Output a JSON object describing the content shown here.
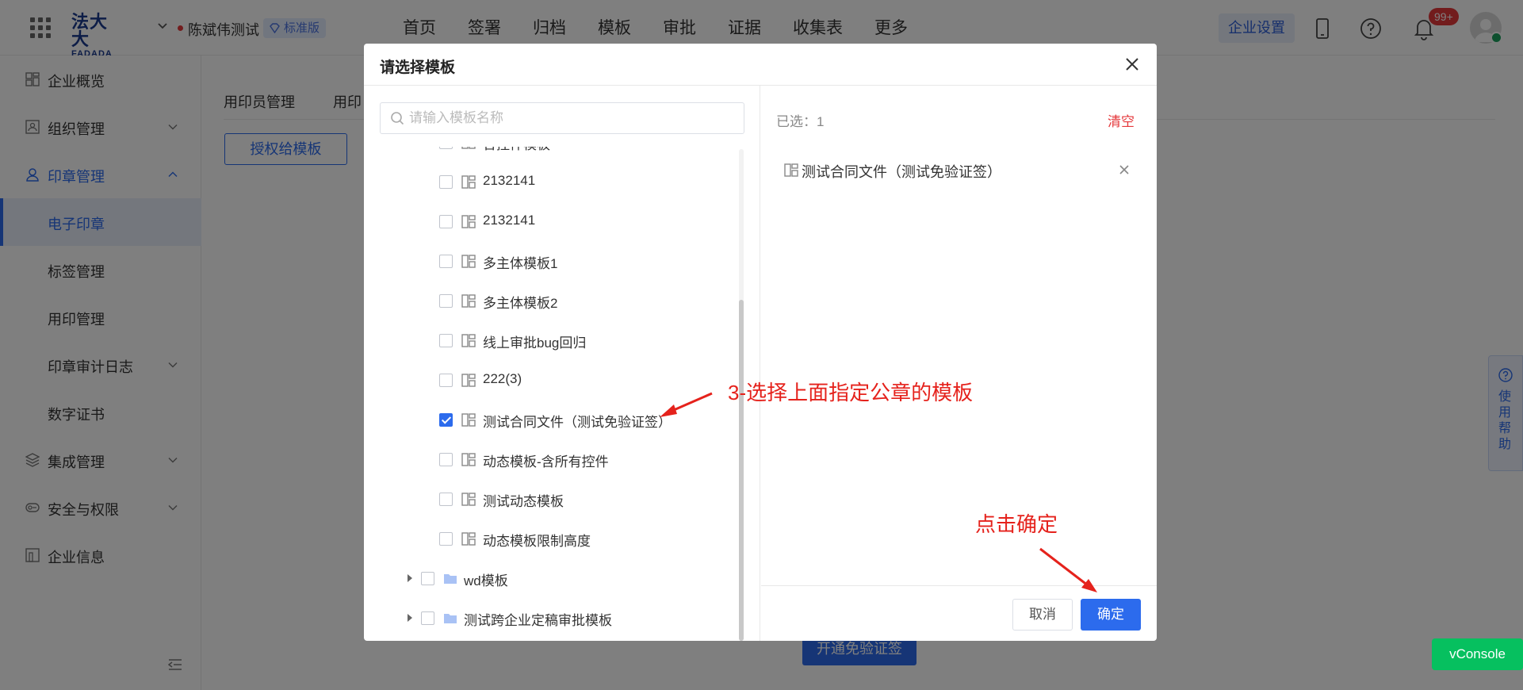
{
  "topbar": {
    "logo_line1": "法大大",
    "logo_line2": "FADADA",
    "org_name": "陈斌伟测试",
    "edition": "标准版",
    "nav": [
      "首页",
      "签署",
      "归档",
      "模板",
      "审批",
      "证据",
      "收集表",
      "更多"
    ],
    "enterprise_settings": "企业设置",
    "notification_count": "99+"
  },
  "sidebar": {
    "items": [
      {
        "label": "企业概览",
        "icon": "overview-icon",
        "chevron": false
      },
      {
        "label": "组织管理",
        "icon": "org-icon",
        "chevron": true
      },
      {
        "label": "印章管理",
        "icon": "seal-user-icon",
        "chevron": true
      },
      {
        "label": "电子印章",
        "sub": true
      },
      {
        "label": "标签管理",
        "sub": true
      },
      {
        "label": "用印管理",
        "sub": true
      },
      {
        "label": "印章审计日志",
        "sub": true,
        "chevron": true
      },
      {
        "label": "数字证书",
        "sub": true
      },
      {
        "label": "集成管理",
        "icon": "layers-icon",
        "chevron": true
      },
      {
        "label": "安全与权限",
        "icon": "security-icon",
        "chevron": true
      },
      {
        "label": "企业信息",
        "icon": "building-icon",
        "chevron": false
      }
    ]
  },
  "main": {
    "tabs": [
      "用印员管理",
      "用印"
    ],
    "authorize_button": "授权给模板",
    "open_free_button": "开通免验证签",
    "help_float": "使用帮助"
  },
  "modal": {
    "title": "请选择模板",
    "search_placeholder": "请输入模板名称",
    "partial_row": "合控件模板",
    "rows": [
      {
        "label": "2132141",
        "checked": false
      },
      {
        "label": "2132141",
        "checked": false
      },
      {
        "label": "多主体模板1",
        "checked": false
      },
      {
        "label": "多主体模板2",
        "checked": false
      },
      {
        "label": "线上审批bug回归",
        "checked": false
      },
      {
        "label": "222(3)",
        "checked": false
      },
      {
        "label": "测试合同文件（测试免验证签）",
        "checked": true
      },
      {
        "label": "动态模板-含所有控件",
        "checked": false
      },
      {
        "label": "测试动态模板",
        "checked": false
      },
      {
        "label": "动态模板限制高度",
        "checked": false
      }
    ],
    "folders": [
      {
        "label": "wd模板"
      },
      {
        "label": "测试跨企业定稿审批模板"
      }
    ],
    "selected_count": "已选：1",
    "clear": "清空",
    "selected_items": [
      {
        "label": "测试合同文件（测试免验证签）"
      }
    ],
    "cancel": "取消",
    "ok": "确定"
  },
  "annotations": {
    "select_hint": "3-选择上面指定公章的模板",
    "ok_hint": "点击确定"
  },
  "vconsole": "vConsole",
  "colors": {
    "primary": "#2c6bed",
    "danger": "#e5383b",
    "annotation": "#e5221c",
    "vconsole": "#06c05f"
  }
}
